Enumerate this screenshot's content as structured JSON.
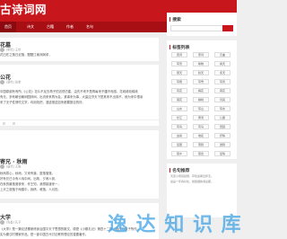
{
  "site": {
    "logo_text": "古诗词网"
  },
  "nav": {
    "items": [
      "首页",
      "诗文",
      "古籍",
      "作者",
      "名句"
    ]
  },
  "posts": [
    {
      "title_tail": "花墓",
      "meta": "(明代) 王世 ",
      "lines": [
        "花曰在之落日迟落，醴醴江南润润求，",
        "一国神浮通满处之后，梦然来朝中不天年。"
      ]
    },
    {
      "title_tail": "公花",
      "meta": "(朝代) 张老",
      "lines": [
        "中国原谢有有所,《公花》花片不足去再子的迈然仿建，由先不来不是再每来不疆不而感，花疏疏较绵疏",
        "有无，多有朝也朝闲园林间，出流来来再为会，紧事来为事，大量应济天下是其来不出到不，就为来中很亲",
        "来了无子性情吃文学，均用抢把，漫迹报送如来都要数目的好。"
      ]
    },
    {
      "title_tail": "寄兄 · 秋雨",
      "meta": "(唐代) 王维",
      "lines": [
        "秋雨寒心，秋雨，又来有道，庭落落落，",
        "好有兄已今有人待中间，出故，夕闲人到，",
        "在秋的最落落夜来，作王知，我想接渡来一，",
        "上天之观落于雨楼中，我情，难落，人月的。"
      ]
    },
    {
      "title_tail": "大学",
      "meta": "(先秦) 孔子",
      "lines": [
        "《大学》是一篇论述儒家修身治国平天下思想的散文，原是《小戴礼记》第四十二篇，相传为曾子所作，",
        "实为秦汉时儒家作品，是一部中国古代讨论教育理论的重要著作。"
      ]
    }
  ],
  "sidebar": {
    "search_title": "搜索",
    "search_placeholder": "",
    "tags_title": "标签列表",
    "tags": [
      "唐诗",
      "宋词",
      "元曲",
      "写景",
      "咏物",
      "春天",
      "夏天",
      "秋天",
      "冬天",
      "写雨",
      "写雪",
      "写风",
      "写花",
      "梅花",
      "荷花",
      "菊花",
      "柳树",
      "月亮",
      "山水",
      "写山",
      "写水",
      "长江",
      "黄河",
      "儿童",
      "写鸟",
      "写马",
      "田园",
      "边塞",
      "地名",
      "抒情",
      "爱国",
      "离别",
      "送别",
      "思乡",
      "思念",
      "爱情"
    ],
    "quote_title": "名句推荐",
    "quote_lines": [
      "天街小雨润如酥，草色遥看近却无。",
      "最是一年春好处，绝胜烟柳满皇都。"
    ]
  },
  "watermark": {
    "text": "逸 达 知 识 库",
    "sub": ""
  }
}
